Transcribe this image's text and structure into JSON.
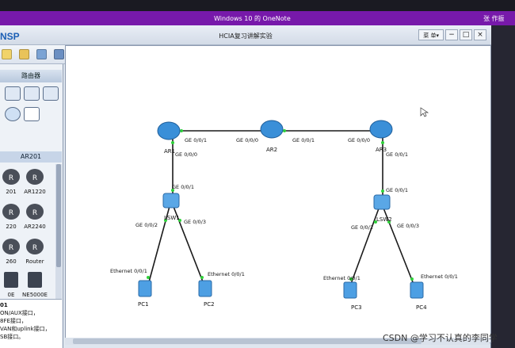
{
  "onenote": {
    "title": "Windows 10 的 OneNote",
    "user": "张 作振"
  },
  "window": {
    "brand": "NSP",
    "caption": "HCIA复习讲解实验",
    "menu_label": "菜 单▾",
    "minimize": "−",
    "maximize": "□",
    "close": "×"
  },
  "panel": {
    "header": "路由器",
    "category": "AR201",
    "devices": [
      "201",
      "AR1220",
      "220",
      "AR2240",
      "260",
      "Router",
      "0E",
      "NE5000E"
    ],
    "desc_title": "01",
    "desc_lines": [
      "ON/AUX接口，",
      "8FE接口，",
      "VAN和uplink接口，",
      "SB接口。"
    ]
  },
  "topology": {
    "nodes": [
      {
        "label": "AR1",
        "kind": "router"
      },
      {
        "label": "AR2",
        "kind": "router"
      },
      {
        "label": "AR3",
        "kind": "router"
      },
      {
        "label": "LSW1",
        "kind": "switch"
      },
      {
        "label": "LSW2",
        "kind": "switch"
      },
      {
        "label": "PC1",
        "kind": "pc"
      },
      {
        "label": "PC2",
        "kind": "pc"
      },
      {
        "label": "PC3",
        "kind": "pc"
      },
      {
        "label": "PC4",
        "kind": "pc"
      }
    ],
    "ports": [
      "GE 0/0/1",
      "GE 0/0/0",
      "GE 0/0/1",
      "GE 0/0/0",
      "GE 0/0/0",
      "GE 0/0/1",
      "GE 0/0/1",
      "GE 0/0/1",
      "GE 0/0/2",
      "GE 0/0/3",
      "GE 0/0/2",
      "GE 0/0/3",
      "Ethernet 0/0/1",
      "Ethernet 0/0/1",
      "Ethernet 0/0/1",
      "Ethernet 0/0/1"
    ],
    "link_color": "#1a1a1a",
    "port_dot_color": "#2fd13a",
    "router_color": "#3a8fd8"
  },
  "watermark": "CSDN @学习不认真的李同学"
}
